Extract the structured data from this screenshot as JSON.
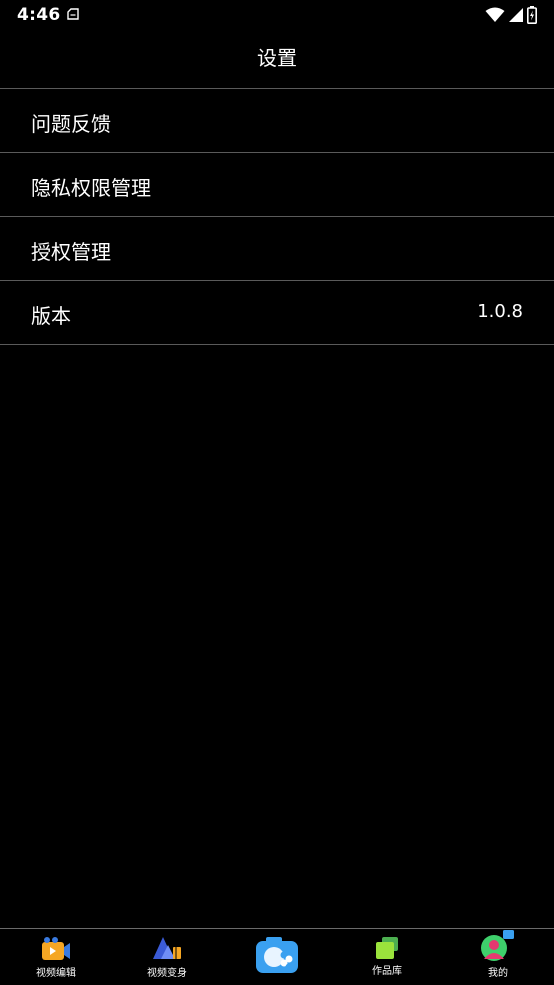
{
  "status_bar": {
    "time": "4:46"
  },
  "header": {
    "title": "设置"
  },
  "settings": {
    "items": [
      {
        "label": "问题反馈",
        "value": ""
      },
      {
        "label": "隐私权限管理",
        "value": ""
      },
      {
        "label": "授权管理",
        "value": ""
      },
      {
        "label": "版本",
        "value": "1.0.8"
      }
    ]
  },
  "tabbar": {
    "tabs": [
      {
        "label": "视频编辑",
        "icon": "video-edit-icon"
      },
      {
        "label": "视频变身",
        "icon": "video-transform-icon"
      },
      {
        "label": "",
        "icon": "camera-icon"
      },
      {
        "label": "作品库",
        "icon": "works-library-icon"
      },
      {
        "label": "我的",
        "icon": "profile-icon"
      }
    ]
  },
  "colors": {
    "background": "#000000",
    "divider": "#5a5a5a",
    "accent_blue": "#3aa0f0"
  }
}
